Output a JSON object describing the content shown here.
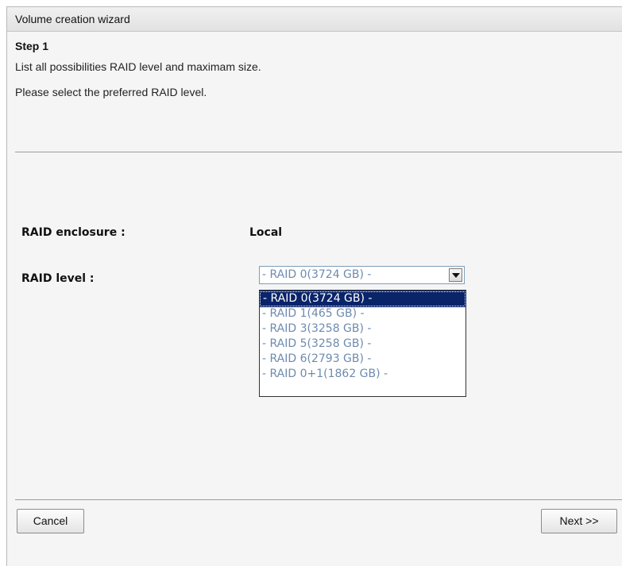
{
  "wizard": {
    "title": "Volume creation wizard",
    "step_title": "Step 1",
    "description": "List all possibilities RAID level and maximam size.",
    "instruction": "Please select the preferred RAID level."
  },
  "form": {
    "enclosure_label": "RAID enclosure :",
    "enclosure_value": "Local",
    "level_label": "RAID level :",
    "level_selected": "- RAID 0(3724 GB) -",
    "level_options": [
      "- RAID 0(3724 GB) -",
      "- RAID 1(465 GB) -",
      "- RAID 3(3258 GB) -",
      "- RAID 5(3258 GB) -",
      "- RAID 6(2793 GB) -",
      "- RAID 0+1(1862 GB) -"
    ],
    "highlighted_option_index": 0
  },
  "buttons": {
    "cancel": "Cancel",
    "next": "Next >>"
  },
  "colors": {
    "selection_bg": "#0a246a",
    "option_text": "#6d8bb0",
    "panel_bg": "#f5f5f5"
  },
  "icons": {
    "dropdown_arrow": "chevron-down-icon"
  }
}
